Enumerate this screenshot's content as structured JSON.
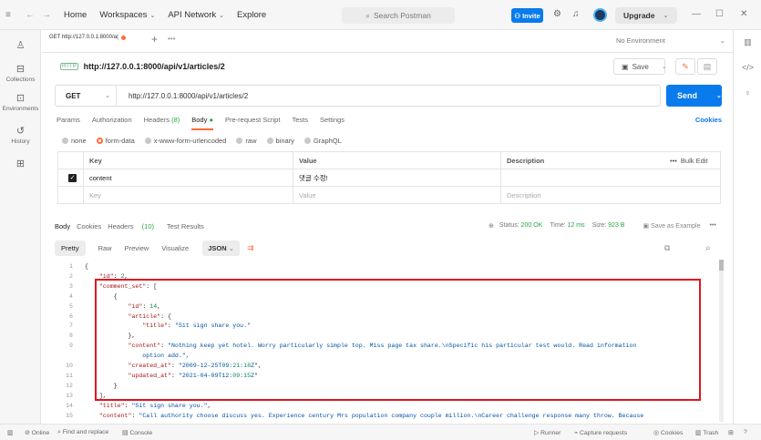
{
  "topbar": {
    "nav": [
      "Home",
      "Workspaces",
      "API Network",
      "Explore"
    ],
    "search_placeholder": "Search Postman",
    "invite_label": "Invite",
    "upgrade_label": "Upgrade"
  },
  "leftbar": {
    "items": [
      {
        "label": "Collections",
        "icon": "collections-icon"
      },
      {
        "label": "Environments",
        "icon": "environments-icon"
      },
      {
        "label": "History",
        "icon": "history-icon"
      }
    ]
  },
  "tabs": {
    "active_tab": "GET http://127.0.0.1:8000/a(",
    "environment": "No Environment"
  },
  "request": {
    "title": "http://127.0.0.1:8000/api/v1/articles/2",
    "badge": "HTTP",
    "method": "GET",
    "url": "http://127.0.0.1:8000/api/v1/articles/2",
    "save_label": "Save",
    "send_label": "Send",
    "tabs": [
      {
        "label": "Params"
      },
      {
        "label": "Authorization"
      },
      {
        "label": "Headers",
        "count": "(8)"
      },
      {
        "label": "Body",
        "active": true
      },
      {
        "label": "Pre-request Script"
      },
      {
        "label": "Tests"
      },
      {
        "label": "Settings"
      }
    ],
    "cookies_label": "Cookies",
    "body_types": [
      "none",
      "form-data",
      "x-www-form-urlencoded",
      "raw",
      "binary",
      "GraphQL"
    ],
    "body_type_selected": "form-data"
  },
  "kv_table": {
    "headers": {
      "key": "Key",
      "value": "Value",
      "description": "Description",
      "bulk": "Bulk Edit"
    },
    "rows": [
      {
        "key": "content",
        "value": "댓글 수정!",
        "description": ""
      }
    ],
    "placeholder": {
      "key": "Key",
      "value": "Value",
      "description": "Description"
    }
  },
  "response": {
    "tabs": [
      "Body",
      "Cookies",
      "Headers",
      "(10)",
      "Test Results"
    ],
    "status_label": "Status:",
    "status": "200 OK",
    "time_label": "Time:",
    "time": "12 ms",
    "size_label": "Size:",
    "size": "923 B",
    "save_example": "Save as Example",
    "views": [
      "Pretty",
      "Raw",
      "Preview",
      "Visualize"
    ],
    "format": "JSON",
    "code_lines": [
      {
        "n": "1",
        "text": "{"
      },
      {
        "n": "2",
        "text": "    \"id\": 2,"
      },
      {
        "n": "3",
        "text": "    \"comment_set\": ["
      },
      {
        "n": "4",
        "text": "        {"
      },
      {
        "n": "5",
        "text": "            \"id\": 14,"
      },
      {
        "n": "6",
        "text": "            \"article\": {"
      },
      {
        "n": "7",
        "text": "                \"title\": \"Sit sign share you.\""
      },
      {
        "n": "8",
        "text": "            },"
      },
      {
        "n": "9",
        "text": "            \"content\": \"Nothing keep yet hotel. Worry particularly simple top. Miss page tax share.\\nSpecific his particular test would. Read information"
      },
      {
        "n": "",
        "text": "                option add.\","
      },
      {
        "n": "10",
        "text": "            \"created_at\": \"2009-12-25T09:21:18Z\","
      },
      {
        "n": "11",
        "text": "            \"updated_at\": \"2021-04-09T12:09:15Z\""
      },
      {
        "n": "12",
        "text": "        }"
      },
      {
        "n": "13",
        "text": "    ],"
      },
      {
        "n": "14",
        "text": "    \"title\": \"Sit sign share you.\","
      },
      {
        "n": "15",
        "text": "    \"content\": \"Call authority choose discuss yes. Experience century Mrs population company couple million.\\nCareer challenge response many throw. Because"
      }
    ]
  },
  "bottombar": {
    "online": "Online",
    "find_replace": "Find and replace",
    "console": "Console",
    "runner": "Runner",
    "capture": "Capture requests",
    "cookies": "Cookies",
    "trash": "Trash"
  },
  "colors": {
    "accent": "#ff6c37",
    "primary": "#097bed",
    "highlight_box": "#e0141e",
    "status_ok": "#27a844"
  }
}
